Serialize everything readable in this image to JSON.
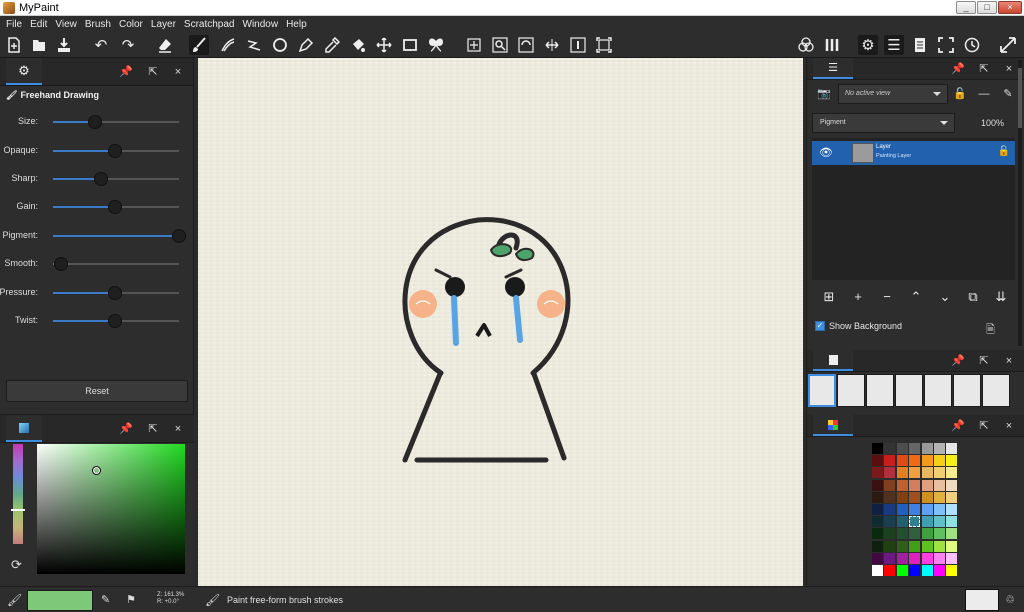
{
  "window": {
    "title": "MyPaint"
  },
  "menu": [
    "File",
    "Edit",
    "View",
    "Brush",
    "Color",
    "Layer",
    "Scratchpad",
    "Window",
    "Help"
  ],
  "toolbar": {
    "left": [
      "new-document-icon",
      "open-document-icon",
      "save-icon",
      "undo-icon",
      "redo-icon",
      "eraser-icon",
      "freehand-brush-icon",
      "inking-icon",
      "line-icon",
      "ellipse-icon",
      "pen-icon",
      "color-picker-icon",
      "fill-icon",
      "pan-icon",
      "frame-icon",
      "symmetry-icon"
    ],
    "view": [
      "move-icon",
      "zoom-icon",
      "rotate-icon",
      "mirror-icon",
      "reset-zoom-icon",
      "fit-view-icon"
    ],
    "right": [
      "color-wheel-icon",
      "brushes-icon",
      "settings-icon",
      "layers-icon",
      "notes-icon",
      "fullscreen-icon",
      "history-icon",
      "expand-icon"
    ]
  },
  "brush_settings": {
    "title": "Freehand Drawing",
    "sliders": [
      {
        "label": "Size:",
        "value": 0.33
      },
      {
        "label": "Opaque:",
        "value": 0.49
      },
      {
        "label": "Sharp:",
        "value": 0.38
      },
      {
        "label": "Gain:",
        "value": 0.49
      },
      {
        "label": "Pigment:",
        "value": 1.0
      },
      {
        "label": "Smooth:",
        "value": 0.06
      },
      {
        "label": "Pressure:",
        "value": 0.49
      },
      {
        "label": "Twist:",
        "value": 0.49
      }
    ],
    "reset_label": "Reset"
  },
  "color": {
    "hue_position": 0.65,
    "sv_point": [
      0.4,
      0.2
    ],
    "current": "#7ec87a"
  },
  "layers": {
    "view_placeholder": "No active view",
    "blend_mode": "Pigment",
    "opacity": "100%",
    "rows": [
      {
        "name": "Layer",
        "type": "Painting Layer"
      }
    ],
    "show_background_label": "Show Background"
  },
  "palette": {
    "rows": [
      [
        "#000000",
        "#333333",
        "#4d4d4d",
        "#666666",
        "#999999",
        "#b3b3b3",
        "#e6e6e6"
      ],
      [
        "#5a0f0f",
        "#c81e1e",
        "#e04a14",
        "#f06a14",
        "#f59a18",
        "#f5cf18",
        "#f5f016"
      ],
      [
        "#7a1a1a",
        "#b03040",
        "#e08020",
        "#f0a040",
        "#e8b860",
        "#f0d070",
        "#f8ec90"
      ],
      [
        "#3a1010",
        "#804020",
        "#c06030",
        "#d08060",
        "#e0a080",
        "#e8c0a0",
        "#f0dcc0"
      ],
      [
        "#2a1a10",
        "#503020",
        "#804010",
        "#a05020",
        "#d09020",
        "#e0b040",
        "#f0d080"
      ],
      [
        "#102040",
        "#1a3a80",
        "#2060c0",
        "#4080e0",
        "#60a0f0",
        "#80c0f8",
        "#b0e0ff"
      ],
      [
        "#102a30",
        "#1a4050",
        "#206070",
        "#308090",
        "#40a0b0",
        "#60c0c8",
        "#90e0e0"
      ],
      [
        "#0a2a10",
        "#1a4020",
        "#205030",
        "#306040",
        "#40a040",
        "#60c060",
        "#a0e080"
      ],
      [
        "#102010",
        "#204010",
        "#306018",
        "#40a018",
        "#60c020",
        "#a0e040",
        "#e0ff80"
      ],
      [
        "#400a40",
        "#6a1a80",
        "#a020a0",
        "#e020c0",
        "#ff40e0",
        "#ff80f0",
        "#ffc0ff"
      ],
      [
        "#ffffff",
        "#ff0000",
        "#00ff00",
        "#0000ff",
        "#00ffff",
        "#ff00ff",
        "#ffff00"
      ]
    ],
    "selected": [
      6,
      3
    ]
  },
  "status": {
    "zoom_line1": "Z: 161.3%",
    "zoom_line2": "R: +0.0°",
    "message": "Paint free-form brush strokes"
  }
}
